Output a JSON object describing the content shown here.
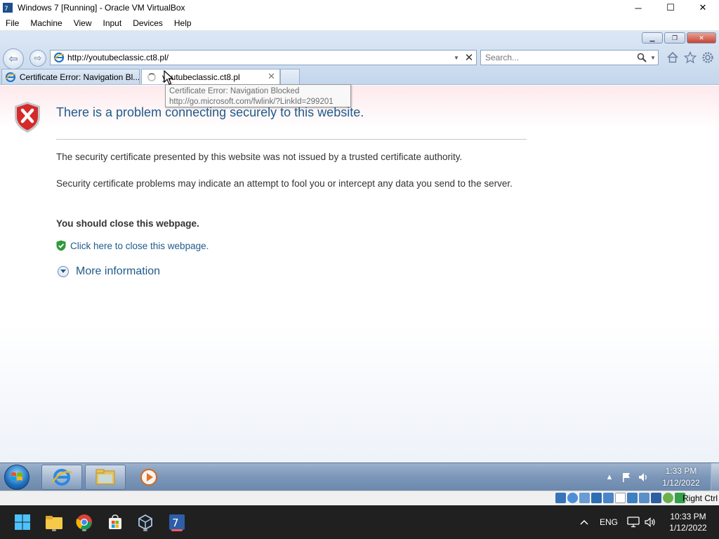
{
  "vbox": {
    "title": "Windows 7 [Running] - Oracle VM VirtualBox",
    "menus": [
      "File",
      "Machine",
      "View",
      "Input",
      "Devices",
      "Help"
    ],
    "window_controls": {
      "minimize": "─",
      "maximize": "☐",
      "close": "✕"
    },
    "host_key": "Right Ctrl"
  },
  "ie": {
    "address": "http://youtubeclassic.ct8.pl/",
    "search_placeholder": "Search...",
    "tabs": [
      {
        "label": "Certificate Error: Navigation Bl...",
        "state": "inactive"
      },
      {
        "label": "youtubeclassic.ct8.pl",
        "state": "active",
        "loading": true
      }
    ],
    "tooltip": {
      "line1": "Certificate Error: Navigation Blocked",
      "line2": "http://go.microsoft.com/fwlink/?LinkId=299201"
    }
  },
  "page": {
    "title": "There is a problem connecting securely to this website.",
    "para1": "The security certificate presented by this website was not issued by a trusted certificate authority.",
    "para2": "Security certificate problems may indicate an attempt to fool you or intercept any data you send to the server.",
    "advice": "You should close this webpage.",
    "close_link": "Click here to close this webpage.",
    "more_info": "More information"
  },
  "win7_taskbar": {
    "clock_time": "1:33 PM",
    "clock_date": "1/12/2022",
    "pinned": [
      "internet-explorer",
      "windows-explorer",
      "media-player"
    ]
  },
  "host_taskbar": {
    "lang": "ENG",
    "clock_time": "10:33 PM",
    "clock_date": "1/12/2022",
    "apps": [
      "start",
      "file-explorer",
      "chrome",
      "microsoft-store",
      "virtualbox",
      "windows7-vm"
    ]
  },
  "colors": {
    "link_blue": "#1f5a8a",
    "error_red": "#d42a2a",
    "host_taskbar": "#202020",
    "active_indicator": "#ff5b5b"
  }
}
